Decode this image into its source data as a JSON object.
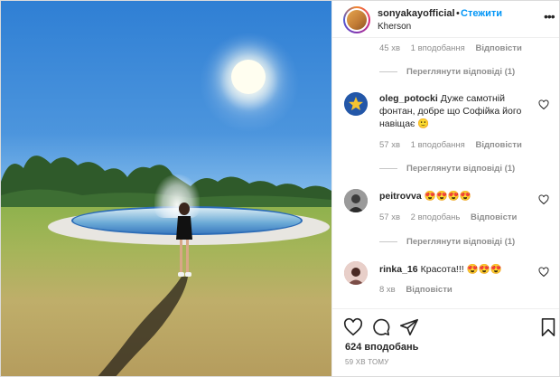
{
  "post": {
    "username": "sonyakayofficial",
    "separator": "•",
    "follow_label": "Стежити",
    "location": "Kherson",
    "more_label": "•••"
  },
  "comments_partial": {
    "meta_time": "45 хв",
    "meta_likes": "1 вподобання",
    "meta_reply": "Відповісти",
    "view_replies": "Переглянути відповіді (1)"
  },
  "comments": [
    {
      "username": "oleg_potocki",
      "text": "Дуже самотній фонтан, добре що Софійка його навіщає 🙂",
      "time": "57 хв",
      "likes": "1 вподобання",
      "reply": "Відповісти",
      "view_replies": "Переглянути відповіді (1)",
      "avatar_color": "#2357a8",
      "avatar_icon": "star-icon"
    },
    {
      "username": "peitrovva",
      "text": "😍😍😍😍",
      "time": "57 хв",
      "likes": "2 вподобань",
      "reply": "Відповісти",
      "view_replies": "Переглянути відповіді (1)",
      "avatar_color": "#6b6b6b",
      "avatar_icon": "portrait-icon"
    },
    {
      "username": "rinka_16",
      "text": "Красота!!! 😍😍😍",
      "time": "8 хв",
      "reply": "Відповісти",
      "avatar_color": "#c98f8a",
      "avatar_icon": "portrait-icon"
    }
  ],
  "actions": {
    "likes_count": "624 вподобань",
    "posted_ago": "59 ХВ ТОМУ"
  },
  "colors": {
    "accent": "#0095f6",
    "muted": "#8e8e8e",
    "text": "#262626"
  }
}
